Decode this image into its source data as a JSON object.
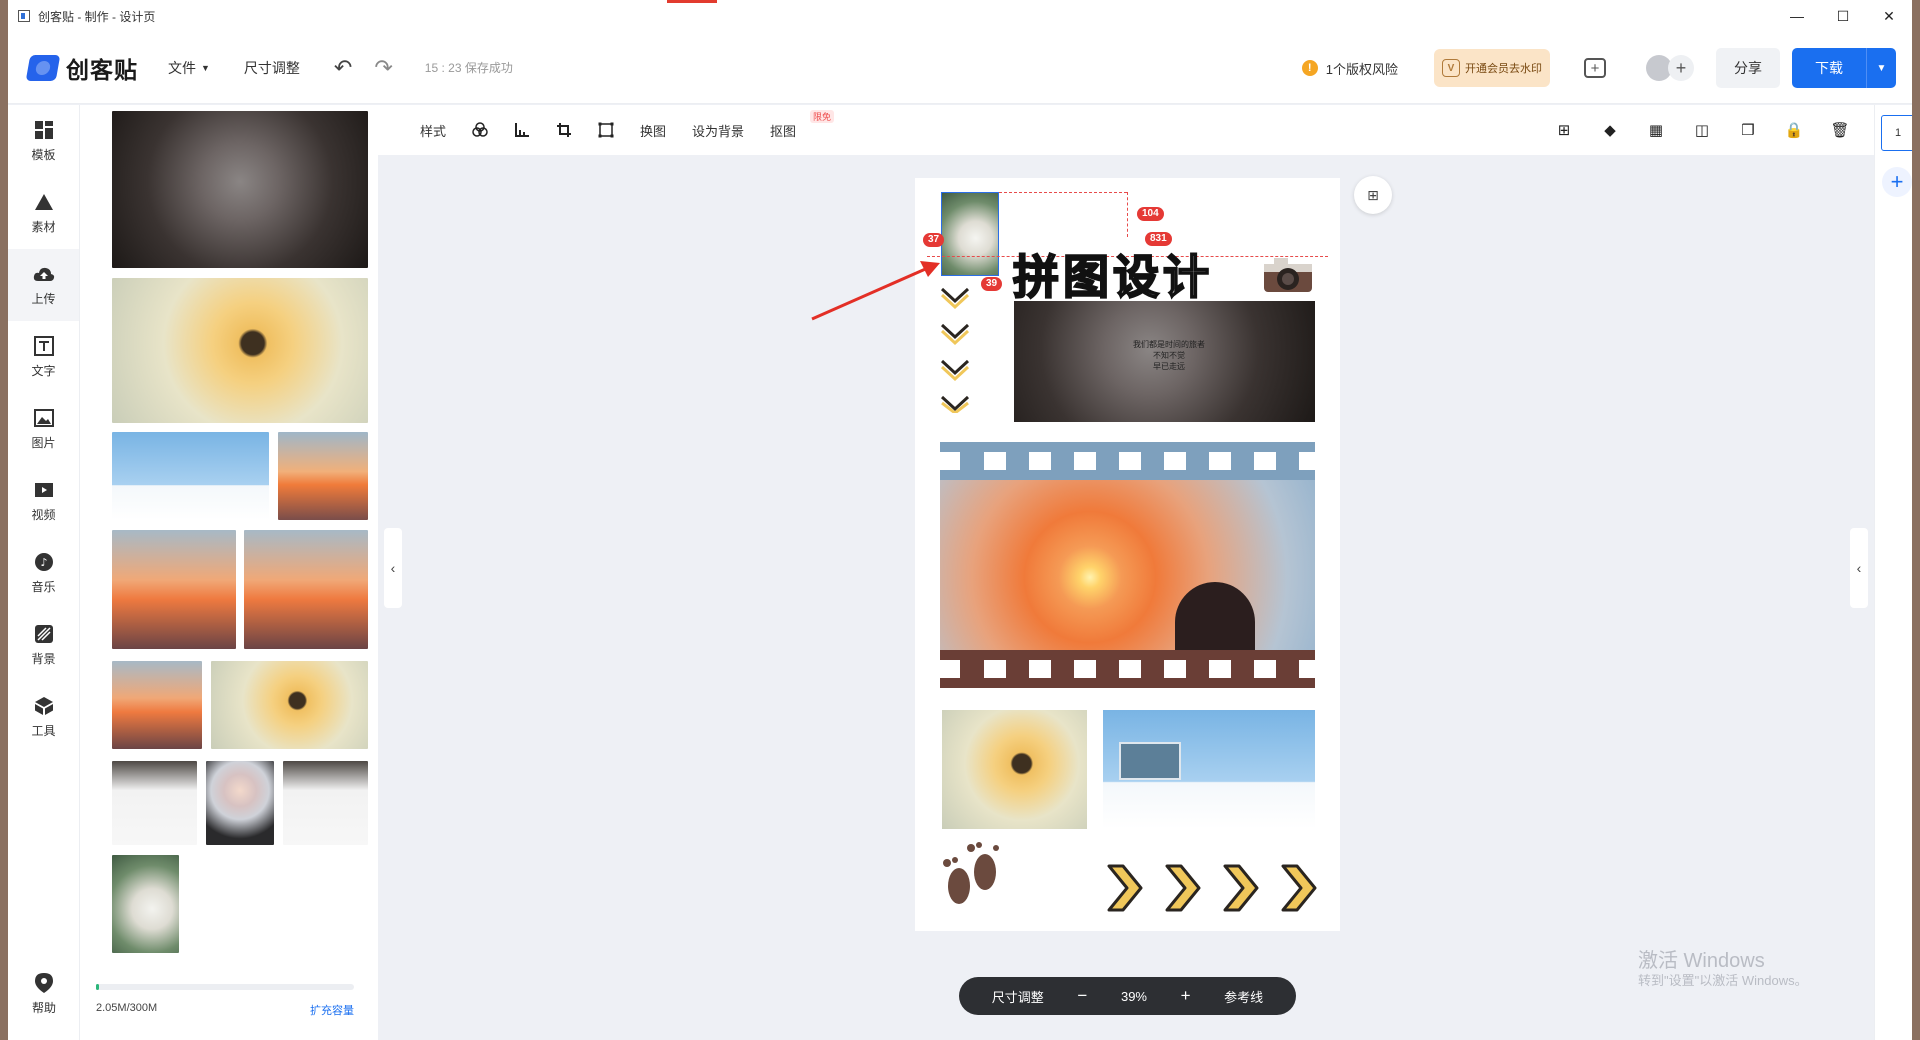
{
  "window": {
    "title": "创客贴 - 制作 - 设计页",
    "controls": [
      "minimize-icon",
      "maximize-icon",
      "close-icon"
    ]
  },
  "header": {
    "logo_text": "创客贴",
    "menu_file": "文件",
    "menu_resize": "尺寸调整",
    "save_status": "15 : 23 保存成功",
    "copyright_risk": "1个版权风险",
    "vip_badge": "V",
    "vip_label": "开通会员去水印",
    "share": "分享",
    "download": "下载"
  },
  "leftnav": {
    "items": [
      {
        "label": "模板",
        "icon": "template-icon"
      },
      {
        "label": "素材",
        "icon": "material-icon"
      },
      {
        "label": "上传",
        "icon": "upload-icon"
      },
      {
        "label": "文字",
        "icon": "text-icon"
      },
      {
        "label": "图片",
        "icon": "image-icon"
      },
      {
        "label": "视频",
        "icon": "video-icon"
      },
      {
        "label": "音乐",
        "icon": "music-icon"
      },
      {
        "label": "背景",
        "icon": "background-icon"
      },
      {
        "label": "工具",
        "icon": "tools-icon"
      }
    ],
    "help": "帮助"
  },
  "upload_panel": {
    "storage_used": "2.05M/300M",
    "storage_fraction": 0.007,
    "expand": "扩充容量"
  },
  "toolbar": {
    "style": "样式",
    "replace": "换图",
    "set_bg": "设为背景",
    "cutout": "抠图",
    "cutout_tag": "限免"
  },
  "canvas": {
    "title_text": "拼图设计",
    "photo_caption_lines": [
      "我们都是时间的旅者",
      "不知不觉",
      "早已走远"
    ],
    "badges": {
      "top": "104",
      "left": "37",
      "bottom": "39",
      "right": "831"
    }
  },
  "pages": {
    "current": "1"
  },
  "zoombar": {
    "resize": "尺寸调整",
    "minus": "−",
    "zoom": "39%",
    "plus": "+",
    "guides": "参考线"
  },
  "watermark": {
    "line1": "激活 Windows",
    "line2": "转到\"设置\"以激活 Windows。"
  },
  "colors": {
    "accent": "#1a6ff0",
    "danger": "#e53935",
    "vip_bg": "#fbe4c7"
  }
}
